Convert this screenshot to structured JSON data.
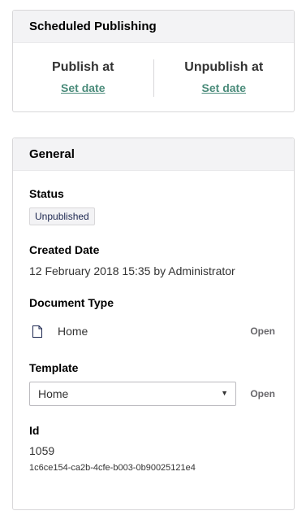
{
  "scheduled": {
    "title": "Scheduled Publishing",
    "publish_label": "Publish at",
    "publish_link": "Set date",
    "unpublish_label": "Unpublish at",
    "unpublish_link": "Set date"
  },
  "general": {
    "title": "General",
    "status_label": "Status",
    "status_value": "Unpublished",
    "created_label": "Created Date",
    "created_value": "12 February 2018 15:35 by Administrator",
    "doctype_label": "Document Type",
    "doctype_value": "Home",
    "doctype_icon": "document-icon",
    "doctype_open": "Open",
    "template_label": "Template",
    "template_selected": "Home",
    "template_open": "Open",
    "id_label": "Id",
    "id_value": "1059",
    "guid_value": "1c6ce154-ca2b-4cfe-b003-0b90025121e4"
  }
}
